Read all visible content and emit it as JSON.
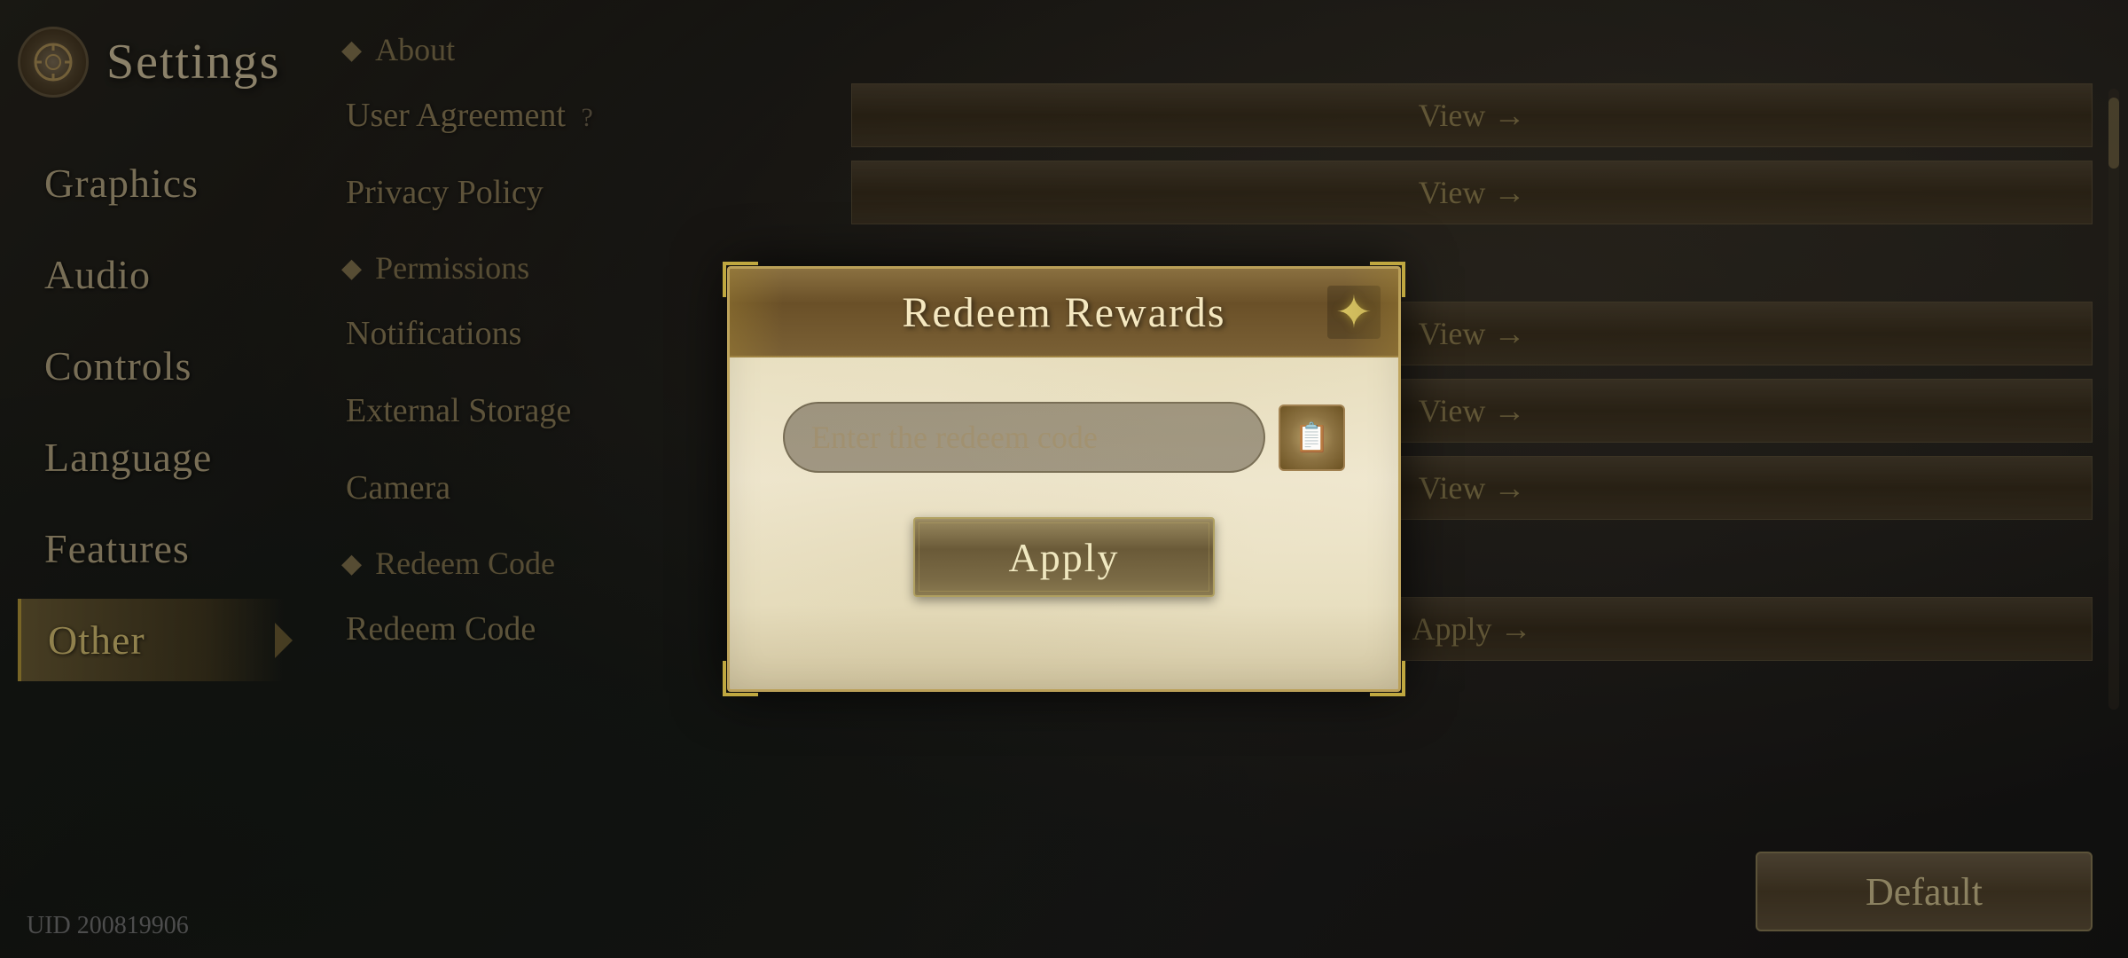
{
  "background": {
    "color": "#1a1a18"
  },
  "settings": {
    "title": "Settings",
    "icon_label": "⚙",
    "uid_label": "UID 200819906"
  },
  "sidebar": {
    "items": [
      {
        "id": "graphics",
        "label": "Graphics",
        "active": false
      },
      {
        "id": "audio",
        "label": "Audio",
        "active": false
      },
      {
        "id": "controls",
        "label": "Controls",
        "active": false
      },
      {
        "id": "language",
        "label": "Language",
        "active": false
      },
      {
        "id": "features",
        "label": "Features",
        "active": false
      },
      {
        "id": "other",
        "label": "Other",
        "active": true
      }
    ]
  },
  "main": {
    "section1": {
      "header": "About"
    },
    "rows": [
      {
        "id": "user-agreement",
        "label": "User Agreement",
        "has_question": true,
        "question_mark": "?",
        "button": "View →"
      },
      {
        "id": "privacy",
        "label": "Privacy Policy",
        "has_question": false,
        "button": "View →"
      },
      {
        "id": "permissions",
        "label": "Permissions",
        "is_section": true,
        "bullet": "◆"
      },
      {
        "id": "notifications",
        "label": "Notifications",
        "button": "View →"
      },
      {
        "id": "external",
        "label": "External Storage",
        "button": "View →"
      },
      {
        "id": "camera",
        "label": "Camera",
        "button": "View →"
      },
      {
        "id": "redeem-section",
        "label": "Redeem Code",
        "is_section": true,
        "bullet": "◆"
      },
      {
        "id": "redeem-code",
        "label": "Redeem Code",
        "button": "Apply →"
      }
    ]
  },
  "default_button": {
    "label": "Default"
  },
  "modal": {
    "title": "Redeem Rewards",
    "close_icon": "✕",
    "close_star": "✦",
    "input_placeholder": "Enter the redeem code",
    "paste_icon": "📋",
    "apply_button_label": "Apply"
  }
}
